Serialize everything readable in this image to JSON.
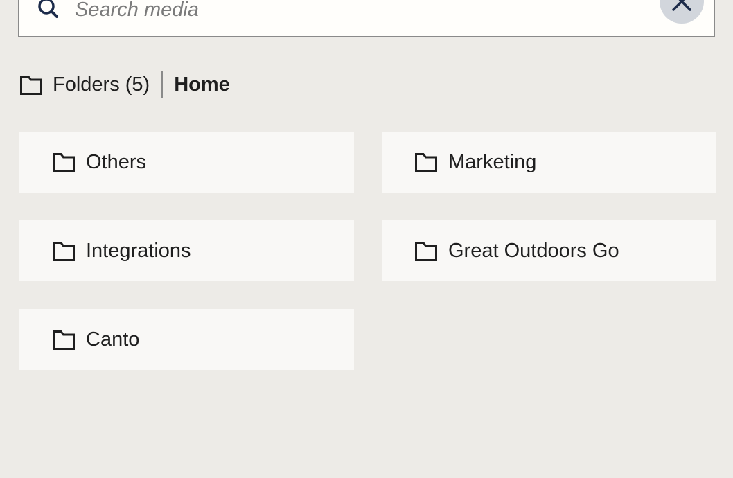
{
  "search": {
    "placeholder": "Search media",
    "value": "",
    "icon": "search-icon",
    "clear_icon": "close-icon"
  },
  "breadcrumb": {
    "icon": "folder-icon",
    "folders_label": "Folders (5)",
    "current": "Home"
  },
  "folders": [
    {
      "label": "Others",
      "icon": "folder-icon"
    },
    {
      "label": "Marketing",
      "icon": "folder-icon"
    },
    {
      "label": "Integrations",
      "icon": "folder-icon"
    },
    {
      "label": "Great Outdoors Go",
      "icon": "folder-icon"
    },
    {
      "label": "Canto",
      "icon": "folder-icon"
    }
  ],
  "colors": {
    "background": "#edebe7",
    "card": "#f9f8f6",
    "accent": "#1c2b4a",
    "clear_button_bg": "#d2d6dc"
  }
}
